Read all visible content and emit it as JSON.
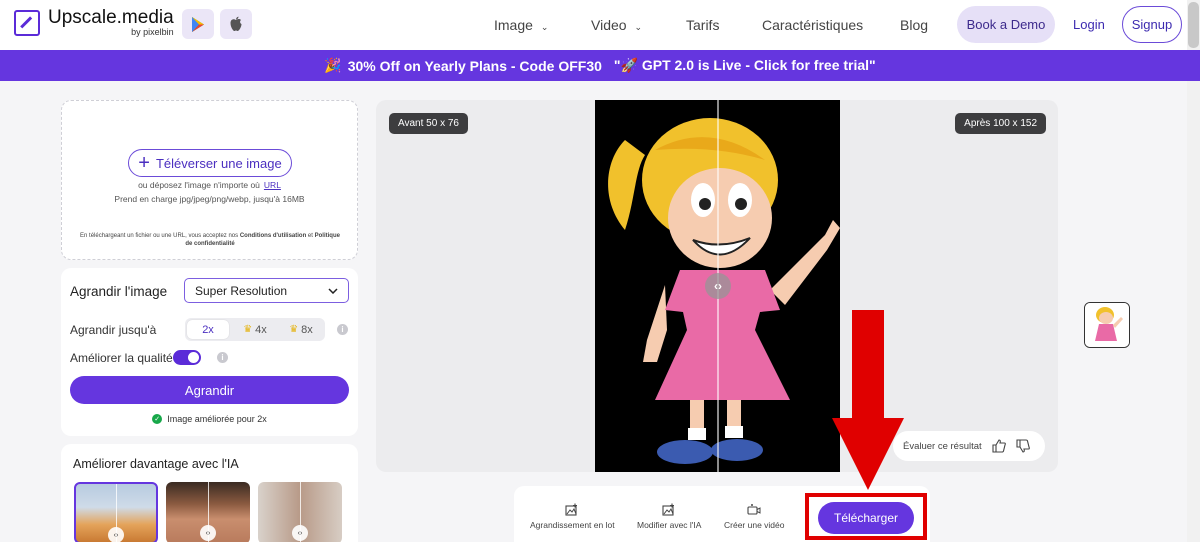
{
  "header": {
    "logo_name": "Upscale.media",
    "logo_sub": "by pixelbin",
    "nav": [
      {
        "label": "Image",
        "has_dropdown": true
      },
      {
        "label": "Video",
        "has_dropdown": true
      },
      {
        "label": "Tarifs"
      },
      {
        "label": "Caractéristiques"
      },
      {
        "label": "Blog"
      }
    ],
    "book_demo": "Book a Demo",
    "login": "Login",
    "signup": "Signup"
  },
  "banner": {
    "promo": "30% Off on Yearly Plans - Code OFF30",
    "gpt": "\"🚀 GPT 2.0 is Live - Click for free trial\""
  },
  "upload": {
    "button": "Téléverser une image",
    "drop_text": "ou déposez l'image n'importe où",
    "url_link": "URL",
    "formats": "Prend en charge jpg/jpeg/png/webp, jusqu'à 16MB",
    "terms_prefix": "En téléchargeant un fichier ou une URL, vous acceptez nos",
    "terms_link": "Conditions d'utilisation",
    "terms_and": "et",
    "privacy_link": "Politique de confidentialité"
  },
  "settings": {
    "upscale_label": "Agrandir l'image",
    "model_selected": "Super Resolution",
    "scale_label": "Agrandir jusqu'à",
    "scale_options": [
      "2x",
      "4x",
      "8x"
    ],
    "scale_selected": "2x",
    "quality_label": "Améliorer la qualité",
    "quality_on": true,
    "action_button": "Agrandir",
    "status": "Image améliorée pour 2x"
  },
  "enhance": {
    "title": "Améliorer davantage avec l'IA"
  },
  "preview": {
    "before_label": "Avant 50 x 76",
    "after_label": "Après 100 x 152",
    "feedback_label": "Évaluer ce résultat"
  },
  "toolbar": {
    "batch": "Agrandissement en lot",
    "edit_ai": "Modifier avec l'IA",
    "create_video": "Créer une vidéo",
    "download": "Télécharger"
  },
  "colors": {
    "brand": "#6536df",
    "annotation_red": "#e00000"
  }
}
